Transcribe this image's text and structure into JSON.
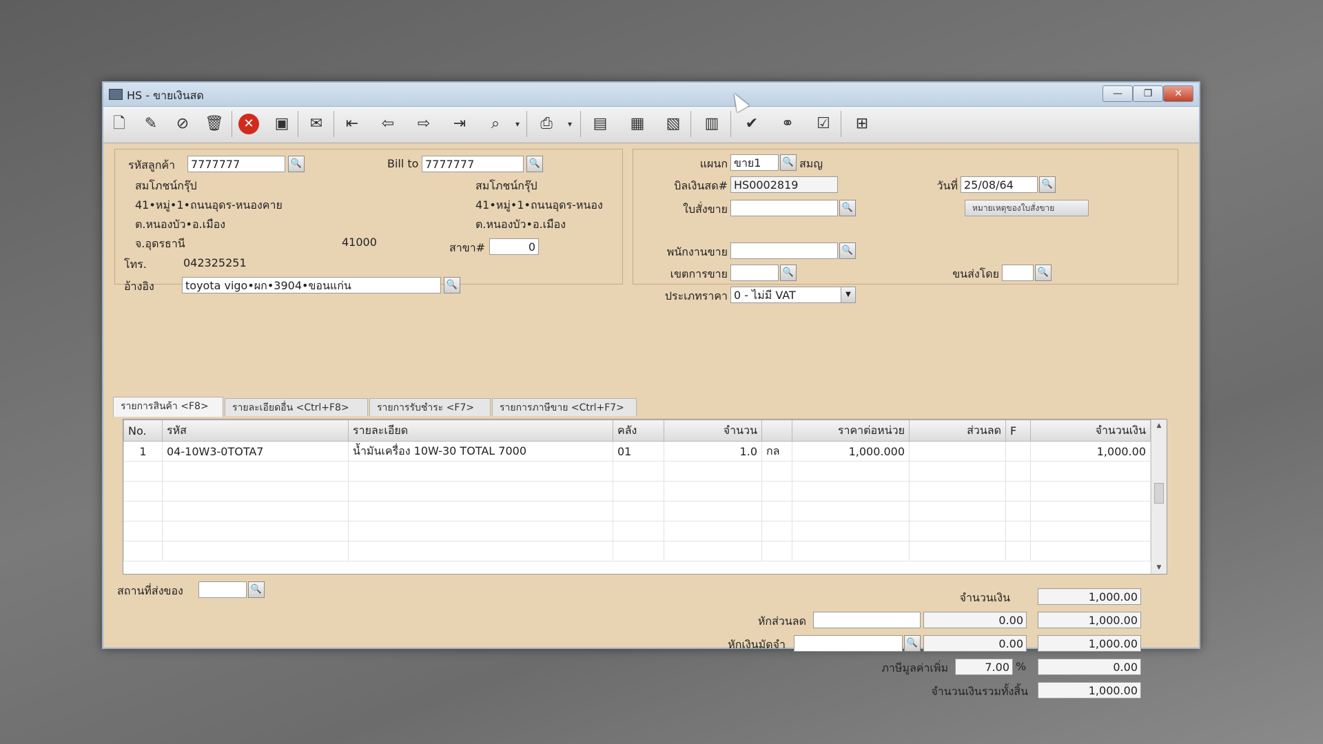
{
  "window": {
    "title": "HS - ขายเงินสด",
    "minimize": "—",
    "maximize": "❐",
    "close": "✕"
  },
  "toolbar": [
    "new-doc-icon",
    "edit-icon",
    "cancel-doc-icon",
    "delete-trash-icon",
    "cancel-red-icon",
    "save-icon",
    "attach-icon",
    "first-record-icon",
    "previous-record-icon",
    "next-record-icon",
    "last-record-icon",
    "search-doc-icon",
    "print-icon",
    "report-icon",
    "calculator-icon",
    "stock-icon",
    "reuse-icon",
    "approve-ok-icon",
    "link-icon",
    "ok-doc-icon",
    "network-icon"
  ],
  "customer": {
    "code_label": "รหัสลูกค้า",
    "code": "7777777",
    "billto_label": "Bill to",
    "billto": "7777777",
    "name": "สมโภชน์กรุ๊ป",
    "addr1": "41•หมู่•1•ถนนอุดร-หนองคาย",
    "addr2": "ต.หนองบัว•อ.เมือง",
    "addr3": "จ.อุดรธานี",
    "zip": "41000",
    "bill_name": "สมโภชน์กรุ๊ป",
    "bill_addr1": "41•หมู่•1•ถนนอุดร-หนอง",
    "bill_addr2": "ต.หนองบัว•อ.เมือง",
    "branch_label": "สาขา#",
    "branch": "0",
    "phone_label": "โทร.",
    "phone": "042325251",
    "ref_label": "อ้างอิง",
    "ref": "toyota vigo•ผก•3904•ขอนแก่น"
  },
  "doc": {
    "dept_label": "แผนก",
    "dept": "ขาย1",
    "dept_name": "สมญ",
    "bill_label": "บิลเงินสด#",
    "bill_no": "HS0002819",
    "date_label": "วันที่",
    "date": "25/08/64",
    "so_label": "ใบสั่งขาย",
    "so": "",
    "so_note_button": "หมายเหตุของใบสั่งขาย",
    "sales_label": "พนักงานขาย",
    "sales": "",
    "area_label": "เขตการขาย",
    "area": "",
    "ship_label": "ขนส่งโดย",
    "ship": "",
    "price_type_label": "ประเภทราคา",
    "price_type": "0 - ไม่มี VAT"
  },
  "tabs": [
    {
      "label": "รายการสินค้า <F8>"
    },
    {
      "label": "รายละเอียดอื่น <Ctrl+F8>"
    },
    {
      "label": "รายการรับชำระ <F7>"
    },
    {
      "label": "รายการภาษีขาย <Ctrl+F7>"
    }
  ],
  "grid": {
    "columns": [
      "No.",
      "รหัส",
      "รายละเอียด",
      "คลัง",
      "จำนวน",
      "",
      "ราคาต่อหน่วย",
      "ส่วนลด",
      "F",
      "จำนวนเงิน"
    ],
    "rows": [
      [
        "1",
        "04-10W3-0TOTA7",
        "น้ำมันเครื่อง 10W-30 TOTAL 7000",
        "01",
        "1.0",
        "กล",
        "1,000.000",
        "",
        "",
        "1,000.00"
      ]
    ]
  },
  "footer": {
    "deliver_label": "สถานที่ส่งของ",
    "deliver": "",
    "amount_label": "จำนวนเงิน",
    "amount": "1,000.00",
    "discount_label": "หักส่วนลด",
    "discount_text": "",
    "discount_value": "0.00",
    "after_discount": "1,000.00",
    "deposit_label": "หักเงินมัดจำ",
    "deposit_text": "",
    "deposit_value": "0.00",
    "after_deposit": "1,000.00",
    "vat_label": "ภาษีมูลค่าเพิ่ม",
    "vat_rate": "7.00",
    "vat_pct": "%",
    "vat_amount": "0.00",
    "total_label": "จำนวนเงินรวมทั้งสิ้น",
    "total": "1,000.00"
  }
}
